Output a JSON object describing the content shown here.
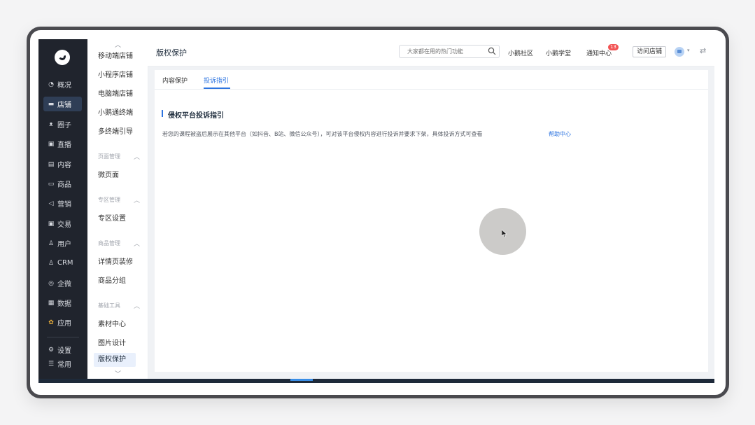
{
  "nav": {
    "items": [
      {
        "icon": "chart-icon",
        "glyph": "◔",
        "label": "概况"
      },
      {
        "icon": "store-icon",
        "glyph": "▬",
        "label": "店铺"
      },
      {
        "icon": "people-icon",
        "glyph": "ᴥ",
        "label": "圈子"
      },
      {
        "icon": "live-icon",
        "glyph": "▣",
        "label": "直播"
      },
      {
        "icon": "content-icon",
        "glyph": "▤",
        "label": "内容"
      },
      {
        "icon": "goods-icon",
        "glyph": "▭",
        "label": "商品"
      },
      {
        "icon": "marketing-icon",
        "glyph": "◁",
        "label": "营销"
      },
      {
        "icon": "trade-icon",
        "glyph": "▣",
        "label": "交易"
      },
      {
        "icon": "user-icon",
        "glyph": "♙",
        "label": "用户"
      },
      {
        "icon": "crm-icon",
        "glyph": "♙",
        "label": "CRM"
      },
      {
        "icon": "wecom-icon",
        "glyph": "◎",
        "label": "企微"
      },
      {
        "icon": "data-icon",
        "glyph": "▦",
        "label": "数据"
      },
      {
        "icon": "apps-icon",
        "glyph": "✿",
        "label": "应用"
      }
    ],
    "bottom": [
      {
        "icon": "settings-icon",
        "glyph": "⚙",
        "label": "设置"
      },
      {
        "icon": "list-icon",
        "glyph": "☰",
        "label": "常用"
      }
    ],
    "active_index": 1
  },
  "submenu": {
    "items": [
      {
        "label": "移动端店铺"
      },
      {
        "label": "小程序店铺"
      },
      {
        "label": "电脑端店铺"
      },
      {
        "label": "小鹅通终端"
      },
      {
        "label": "多终端引导"
      }
    ],
    "groups": [
      {
        "title": "页面管理",
        "items": [
          "微页面"
        ]
      },
      {
        "title": "专区管理",
        "items": [
          "专区设置"
        ]
      },
      {
        "title": "商品管理",
        "items": [
          "详情页装修",
          "商品分组"
        ]
      },
      {
        "title": "基础工具",
        "items": [
          "素材中心",
          "图片设计",
          "版权保护"
        ]
      }
    ],
    "active": "版权保护"
  },
  "header": {
    "title": "版权保护",
    "search_placeholder": "大家都在用的热门功能",
    "links": [
      "小鹅社区",
      "小鹅学堂",
      "通知中心"
    ],
    "notification_count": "13",
    "visit_store": "访问店铺"
  },
  "tabs": [
    "内容保护",
    "投诉指引"
  ],
  "active_tab": "投诉指引",
  "section": {
    "title": "侵权平台投诉指引",
    "description": "若您的课程被盗后展示在其他平台（如抖音、B站、微信公众号），可对该平台侵权内容进行投诉并要求下架，具体投诉方式可查看",
    "help_link": "帮助中心"
  },
  "colors": {
    "accent": "#2d74e0",
    "sidebar": "#20242d",
    "badge": "#f25353"
  }
}
